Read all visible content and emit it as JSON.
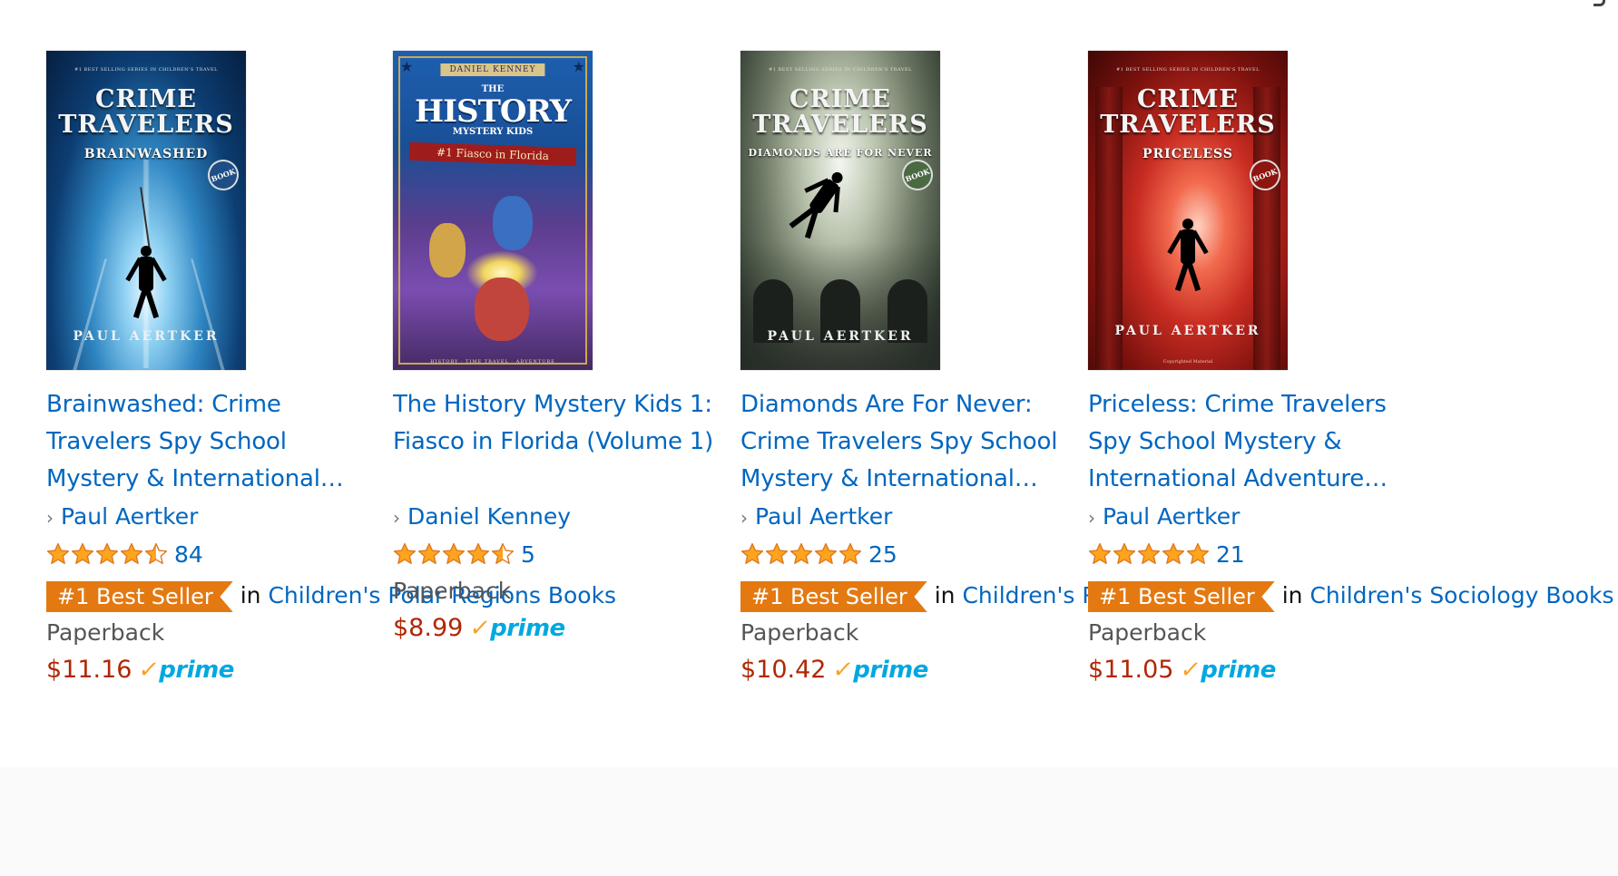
{
  "books": [
    {
      "title": "Brainwashed: Crime Travelers Spy School Mystery & International…",
      "author": "Paul Aertker",
      "stars": 4.5,
      "rating_count": "84",
      "best_seller_badge": "#1 Best Seller",
      "best_seller_in": "in",
      "best_seller_category": "Children's Polar Regions Books",
      "format": "Paperback",
      "price": "$11.16",
      "prime": "prime",
      "cover": {
        "top_line": "#1 BEST SELLING SERIES IN CHILDREN'S TRAVEL",
        "series": "CRIME TRAVELERS",
        "subtitle": "BRAINWASHED",
        "badge": "BOOK",
        "author": "PAUL AERTKER"
      }
    },
    {
      "title": "The History Mystery Kids 1: Fiasco in Florida (Volume 1)",
      "author": "Daniel Kenney",
      "stars": 4.5,
      "rating_count": "5",
      "best_seller_badge": "",
      "best_seller_in": "",
      "best_seller_category": "",
      "format": "Paperback",
      "price": "$8.99",
      "prime": "prime",
      "cover": {
        "author_band": "DANIEL KENNEY",
        "the": "THE",
        "big": "HISTORY",
        "small": "MYSTERY KIDS",
        "ribbon": "#1 Fiasco in Florida",
        "footer": "HISTORY · TIME TRAVEL · ADVENTURE"
      }
    },
    {
      "title": "Diamonds Are For Never: Crime Travelers Spy School Mystery & International…",
      "author": "Paul Aertker",
      "stars": 5,
      "rating_count": "25",
      "best_seller_badge": "#1 Best Seller",
      "best_seller_in": "in",
      "best_seller_category": "Children's Pirate Books",
      "format": "Paperback",
      "price": "$10.42",
      "prime": "prime",
      "cover": {
        "top_line": "#1 BEST SELLING SERIES IN CHILDREN'S TRAVEL",
        "series": "CRIME TRAVELERS",
        "subtitle": "DIAMONDS ARE FOR NEVER",
        "badge": "BOOK",
        "author": "PAUL AERTKER"
      }
    },
    {
      "title": "Priceless: Crime Travelers Spy School Mystery & International Adventure…",
      "author": "Paul Aertker",
      "stars": 5,
      "rating_count": "21",
      "best_seller_badge": "#1 Best Seller",
      "best_seller_in": "in",
      "best_seller_category": "Children's Sociology Books",
      "format": "Paperback",
      "price": "$11.05",
      "prime": "prime",
      "cover": {
        "top_line": "#1 BEST SELLING SERIES IN CHILDREN'S TRAVEL",
        "series": "CRIME TRAVELERS",
        "subtitle": "PRICELESS",
        "badge": "BOOK",
        "author": "PAUL AERTKER",
        "footer": "Copyrighted Material"
      }
    }
  ],
  "colors": {
    "link": "#0066c0",
    "price": "#b12704",
    "best_seller": "#e47911",
    "star": "#ffa41c",
    "prime_check": "#f7a12c",
    "prime_text": "#00a8e1"
  },
  "icons": {
    "author_chevron": "chevron-right-icon",
    "star": "star-icon",
    "prime_check": "prime-check-icon"
  }
}
